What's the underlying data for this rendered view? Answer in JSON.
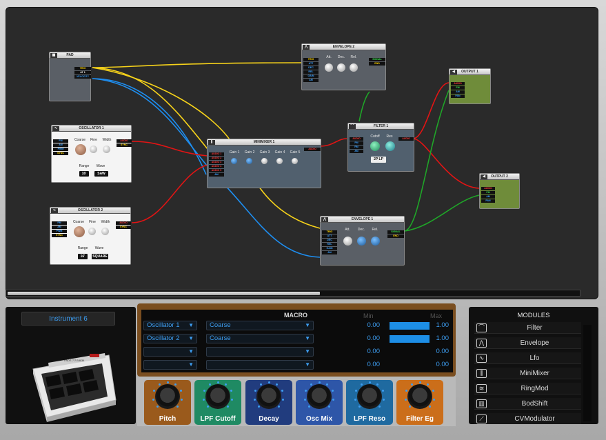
{
  "modules": {
    "pad": {
      "title": "PAD",
      "outs": [
        "TRIG",
        "AT 1",
        "VELOCITY"
      ]
    },
    "osc1": {
      "title": "OSCILLATOR 1",
      "ins": [
        "FM",
        "AM",
        "PWM",
        "SYNC"
      ],
      "outs": [
        "AUDIO",
        "SYNC"
      ],
      "knobs": [
        "Coarse",
        "Fine",
        "Width"
      ],
      "range_label": "Range",
      "wave_label": "Wave",
      "range": "16'",
      "wave": "SAW"
    },
    "osc2": {
      "title": "OSCILLATOR 2",
      "ins": [
        "FM",
        "AM",
        "PWM",
        "SYNC"
      ],
      "outs": [
        "AUDIO",
        "SYNC"
      ],
      "knobs": [
        "Coarse",
        "Fine",
        "Width"
      ],
      "range_label": "Range",
      "wave_label": "Wave",
      "range": "16'",
      "wave": "SQUARE"
    },
    "minimixer": {
      "title": "MINIMIXER 1",
      "ins": [
        "AUDIO 1",
        "AUDIO 2",
        "AUDIO 3",
        "AUDIO 4",
        "AUDIO 5",
        "AM"
      ],
      "outs": [
        "AUDIO"
      ],
      "knobs": [
        "Gain 1",
        "Gain 2",
        "Gain 3",
        "Gain 4",
        "Gain 5"
      ]
    },
    "env2": {
      "title": "ENVELOPE 2",
      "ins": [
        "TRIG",
        "ATT",
        "DEC",
        "REL",
        "GAIN",
        "AM"
      ],
      "outs": [
        "SIGNAL",
        "END"
      ],
      "knobs": [
        "Att.",
        "Dec.",
        "Rel."
      ]
    },
    "env1": {
      "title": "ENVELOPE 1",
      "ins": [
        "TRIG",
        "ATT",
        "DEC",
        "REL",
        "GAIN",
        "AM"
      ],
      "outs": [
        "SIGNAL",
        "END"
      ],
      "knobs": [
        "Att.",
        "Dec.",
        "Rel."
      ]
    },
    "filter": {
      "title": "FILTER 1",
      "ins": [
        "AUDIO",
        "FM",
        "RM",
        "AM"
      ],
      "outs": [
        "AUDIO"
      ],
      "knobs": [
        "Cutoff",
        "Res"
      ],
      "mode": "2P LP"
    },
    "out1": {
      "title": "OUTPUT 1",
      "ins": [
        "AUDIO",
        "FM",
        "AM",
        "PAN"
      ]
    },
    "out2": {
      "title": "OUTPUT 2",
      "ins": [
        "AUDIO",
        "FM",
        "AM",
        "PAN"
      ]
    }
  },
  "instrument": {
    "name": "Instrument 6",
    "device_text": "PADS 7/7/3/8/34"
  },
  "macro": {
    "title": "MACRO",
    "min_label": "Min",
    "max_label": "Max",
    "rows": [
      {
        "module": "Oscillator 1",
        "param": "Coarse",
        "min": "0.00",
        "max": "1.00",
        "fill": 1.0
      },
      {
        "module": "Oscillator 2",
        "param": "Coarse",
        "min": "0.00",
        "max": "1.00",
        "fill": 1.0
      },
      {
        "module": "",
        "param": "",
        "min": "0.00",
        "max": "0.00",
        "fill": 0
      },
      {
        "module": "",
        "param": "",
        "min": "0.00",
        "max": "0.00",
        "fill": 0
      }
    ],
    "knobs": [
      {
        "label": "Pitch",
        "color": "#9a5a1c"
      },
      {
        "label": "LPF Cutoff",
        "color": "#1f8a63"
      },
      {
        "label": "Decay",
        "color": "#213c7e"
      },
      {
        "label": "Osc Mix",
        "color": "#2e56a8"
      },
      {
        "label": "LPF Reso",
        "color": "#1f6aa0"
      },
      {
        "label": "Filter Eg",
        "color": "#cb6e1a"
      }
    ]
  },
  "modules_panel": {
    "title": "MODULES",
    "items": [
      {
        "name": "Filter",
        "icon": "⌒"
      },
      {
        "name": "Envelope",
        "icon": "⋀"
      },
      {
        "name": "Lfo",
        "icon": "∿"
      },
      {
        "name": "MiniMixer",
        "icon": "⫼"
      },
      {
        "name": "RingMod",
        "icon": "≋"
      },
      {
        "name": "BodShift",
        "icon": "▥"
      },
      {
        "name": "CVModulator",
        "icon": "⟋"
      }
    ]
  }
}
